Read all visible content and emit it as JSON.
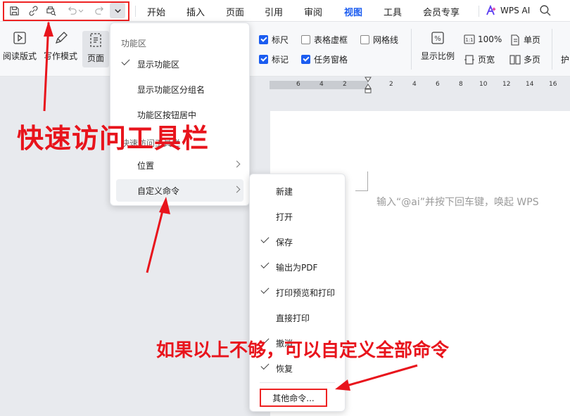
{
  "tabs": [
    "开始",
    "插入",
    "页面",
    "引用",
    "审阅",
    "视图",
    "工具",
    "会员专享"
  ],
  "active_tab": "视图",
  "wps_ai_label": "WPS AI",
  "ribbon": {
    "read_mode": "阅读版式",
    "write_mode": "写作模式",
    "page": "页面",
    "ruler": "标尺",
    "table_gridlines": "表格虚框",
    "gridlines": "网格线",
    "marks": "标记",
    "task_pane": "任务窗格",
    "zoom_label": "显示比例",
    "zoom_100": "100%",
    "page_width": "页宽",
    "single_page": "单页",
    "multi_page": "多页",
    "cut_off_label": "护"
  },
  "checkboxes": {
    "ruler": true,
    "table_gridlines": false,
    "gridlines": false,
    "marks": true,
    "task_pane": true
  },
  "ruler_ticks": [
    "6",
    "4",
    "2",
    "2",
    "4",
    "6",
    "8",
    "10",
    "12",
    "14",
    "16"
  ],
  "doc_hint": "输入“@ai”并按下回车键，唤起 WPS",
  "menu1": {
    "header": "功能区",
    "items": [
      {
        "label": "显示功能区",
        "checked": true
      },
      {
        "label": "显示功能区分组名",
        "checked": false
      },
      {
        "label": "功能区按钮居中",
        "checked": false
      }
    ],
    "qat_header": "快速访问工具栏",
    "position": "位置",
    "custom_cmd": "自定义命令"
  },
  "menu2": {
    "items": [
      {
        "label": "新建",
        "checked": false
      },
      {
        "label": "打开",
        "checked": false
      },
      {
        "label": "保存",
        "checked": true
      },
      {
        "label": "输出为PDF",
        "checked": true
      },
      {
        "label": "打印预览和打印",
        "checked": true
      },
      {
        "label": "直接打印",
        "checked": false
      },
      {
        "label": "撤消",
        "checked": true
      },
      {
        "label": "恢复",
        "checked": true
      }
    ],
    "more": "其他命令..."
  },
  "annotations": {
    "qat_title": "快速访问工具栏",
    "custom_note": "如果以上不够，可以自定义全部命令"
  },
  "colors": {
    "accent": "#1b5cf0",
    "annotation": "#e8141c"
  }
}
